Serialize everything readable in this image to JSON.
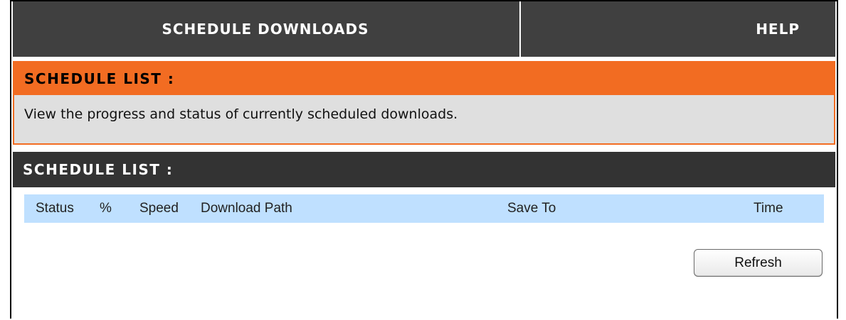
{
  "nav": {
    "main_tab": "SCHEDULE DOWNLOADS",
    "help_tab": "HELP"
  },
  "info_section": {
    "title": "SCHEDULE LIST :",
    "description": "View the progress and status of currently scheduled downloads."
  },
  "list_section": {
    "title": "SCHEDULE LIST :",
    "columns": [
      "Status",
      "%",
      "Speed",
      "Download Path",
      "Save To",
      "Time"
    ],
    "refresh_label": "Refresh"
  },
  "colors": {
    "nav_bg": "#404040",
    "accent_orange": "#f26c22",
    "panel_gray": "#dfdfdf",
    "section_dark": "#333333",
    "table_header_blue": "#bfe0ff"
  }
}
